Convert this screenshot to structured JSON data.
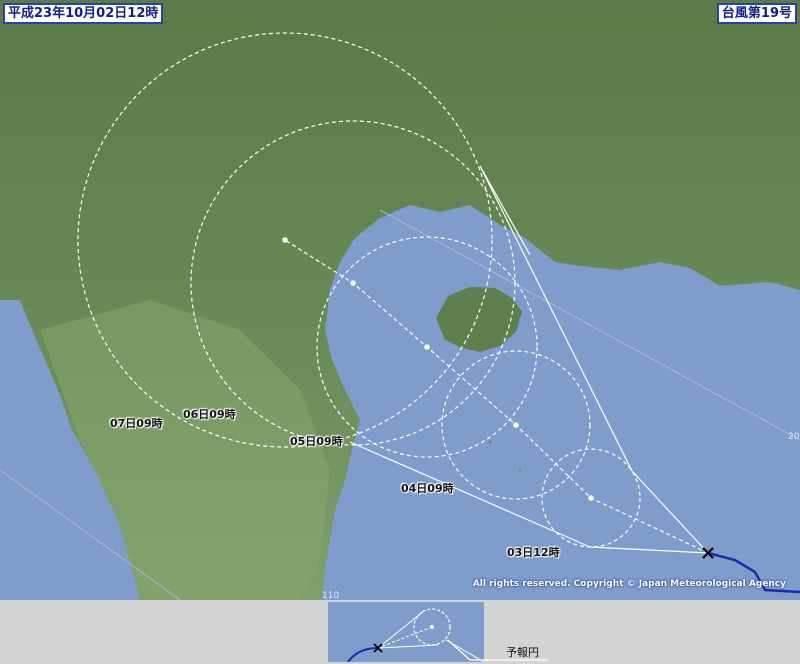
{
  "header": {
    "date": "平成23年10月02日12時",
    "storm": "台風第19号"
  },
  "track_labels": {
    "t1": "03日12時",
    "t2": "04日09時",
    "t3": "05日09時",
    "t4": "06日09時",
    "t5": "07日09時"
  },
  "grid_labels": {
    "lon": "110",
    "lat": "20"
  },
  "copyright": "All rights reserved. Copyright © Japan Meteorological Agency",
  "legend": {
    "label": "予報円"
  },
  "colors": {
    "sea": "#7f9ccb",
    "land": "#5d7d4b",
    "track": "#1a2bb0",
    "forecast": "#ffffff"
  }
}
